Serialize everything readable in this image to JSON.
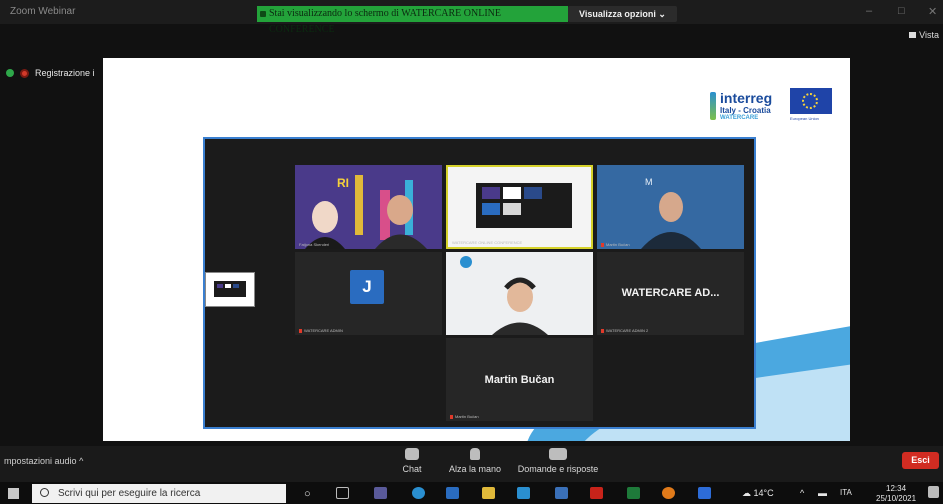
{
  "window": {
    "app_title": "Zoom Webinar",
    "share_banner": "Stai visualizzando lo schermo di WATERCARE ONLINE CONFERENCE",
    "view_options": "Visualizza opzioni",
    "view_label": "Vista",
    "recording": "Registrazione i"
  },
  "slide": {
    "logo_name": "interreg",
    "logo_sub": "Italy - Croatia",
    "logo_project": "WATERCARE",
    "eu_caption": "European Union"
  },
  "gallery": {
    "tile_j_initial": "J",
    "tile_watercare_name": "WATERCARE AD...",
    "tile_martin_name": "Martin Bučan",
    "labels": {
      "t1": "Fatjona Skenderi",
      "t2": "WATERCARE ONLINE CONFERENCE",
      "t3": "Martin Bučan",
      "t4": "WATERCARE ADMIN",
      "t5": "",
      "t6": "WATERCARE ADMIN 2",
      "t7": "Martin Bučan"
    }
  },
  "toolbar": {
    "audio": "mpostazioni audio",
    "chat": "Chat",
    "raise_hand": "Alza la mano",
    "qa": "Domande e risposte",
    "exit": "Esci"
  },
  "taskbar": {
    "search_placeholder": "Scrivi qui per eseguire la ricerca",
    "weather": "14°C",
    "language": "ITA",
    "time": "12:34",
    "date": "25/10/2021"
  },
  "colors": {
    "share_green": "#23a33a",
    "exit_red": "#d12c22",
    "avatar_blue": "#2a6cc0",
    "gallery_border": "#3a7fd0"
  }
}
